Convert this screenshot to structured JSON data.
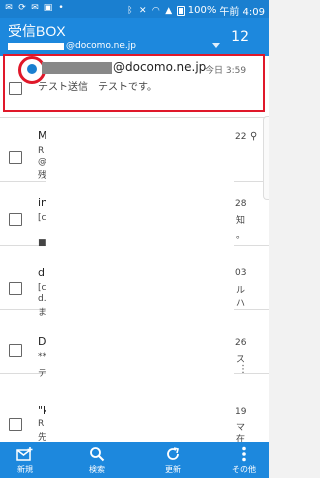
{
  "status": {
    "battery": "100%",
    "time": "午前 4:09"
  },
  "header": {
    "title": "受信BOX",
    "account_domain": "@docomo.ne.jp",
    "count": "12"
  },
  "first_mail": {
    "sender_domain": "@docomo.ne.jp",
    "date": "今日 3:59",
    "preview": "テスト送信　テストです。"
  },
  "rows": [
    {
      "peek_left": "M",
      "peek_left2": "R",
      "peek_left3": "@",
      "peek_left4": "残",
      "peek_right": "22",
      "peek_right2": ""
    },
    {
      "peek_left": "in",
      "peek_left2": "[c",
      "peek_left3": "■",
      "peek_right": "28",
      "peek_right2": "知",
      "peek_right3": "。"
    },
    {
      "peek_left": "d",
      "peek_left2": "[c",
      "peek_left3": "d.",
      "peek_left4": "ま",
      "peek_right": "03",
      "peek_right2": "ル",
      "peek_right3": "ハ"
    },
    {
      "peek_left": "D",
      "peek_left2": "**",
      "peek_left3": "テ",
      "peek_right": "26",
      "peek_right2": "ス",
      "peek_right3": ""
    },
    {
      "peek_left": "\"k",
      "peek_left2": "R",
      "peek_left3": "先",
      "peek_right": "19",
      "peek_right2": "マ",
      "peek_right3": "在"
    }
  ],
  "bottom": {
    "new": "新規",
    "search": "検索",
    "refresh": "更新",
    "other": "その他"
  },
  "colors": {
    "header": "#1d88dd",
    "highlight": "#e0182a",
    "unread_dot": "#1a7fd0"
  }
}
